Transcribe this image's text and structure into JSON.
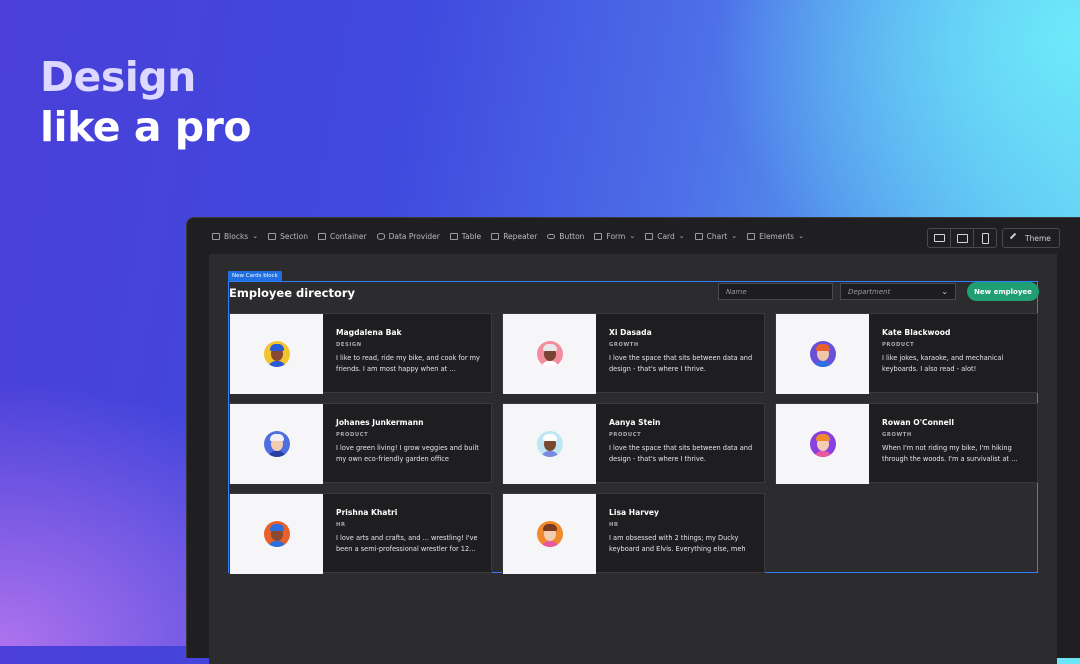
{
  "hero": {
    "line1": "Design",
    "line2": "like a pro"
  },
  "toolbar": {
    "items": [
      {
        "label": "Blocks",
        "icon": "blocks-icon",
        "dropdown": true
      },
      {
        "label": "Section",
        "icon": "section-icon",
        "dropdown": false
      },
      {
        "label": "Container",
        "icon": "container-icon",
        "dropdown": false
      },
      {
        "label": "Data Provider",
        "icon": "database-icon",
        "dropdown": false
      },
      {
        "label": "Table",
        "icon": "table-icon",
        "dropdown": false
      },
      {
        "label": "Repeater",
        "icon": "repeater-icon",
        "dropdown": false
      },
      {
        "label": "Button",
        "icon": "button-icon",
        "dropdown": false
      },
      {
        "label": "Form",
        "icon": "form-icon",
        "dropdown": true
      },
      {
        "label": "Card",
        "icon": "card-icon",
        "dropdown": true
      },
      {
        "label": "Chart",
        "icon": "chart-icon",
        "dropdown": true
      },
      {
        "label": "Elements",
        "icon": "elements-icon",
        "dropdown": true
      }
    ],
    "devices": [
      "desktop-icon",
      "tablet-icon",
      "mobile-icon"
    ],
    "theme_label": "Theme"
  },
  "canvas": {
    "block_tag": "New Cards block",
    "title": "Employee directory",
    "name_placeholder": "Name",
    "department_placeholder": "Department",
    "new_button": "New employee"
  },
  "employees": [
    {
      "name": "Magdalena Bak",
      "department": "DESIGN",
      "bio": "I like to read, ride my bike, and cook for my friends. I am most happy when at …",
      "avatar_bg": "#f4c430",
      "hair": "#2a5bd7",
      "skin": "#8a4a32",
      "shirt": "#2a5bd7"
    },
    {
      "name": "Xi Dasada",
      "department": "GROWTH",
      "bio": "I love the space that sits between data and design - that's where I thrive.",
      "avatar_bg": "#f28c9e",
      "hair": "#e8e8ea",
      "skin": "#7a4230",
      "shirt": "#ffffff"
    },
    {
      "name": "Kate Blackwood",
      "department": "PRODUCT",
      "bio": "I like jokes, karaoke, and mechanical keyboards.  I also read - alot!",
      "avatar_bg": "#6a4fd8",
      "hair": "#e8612c",
      "skin": "#f0c6a8",
      "shirt": "#2f6fe0"
    },
    {
      "name": "Johanes Junkermann",
      "department": "PRODUCT",
      "bio": "I love green living! I grow veggies and built my own eco-friendly garden office",
      "avatar_bg": "#4f6fe0",
      "hair": "#f2f2f4",
      "skin": "#f3cdb2",
      "shirt": "#2a3fa0"
    },
    {
      "name": "Aanya Stein",
      "department": "PRODUCT",
      "bio": "I love the space that sits between data and design - that's where I thrive.",
      "avatar_bg": "#bfe6f2",
      "hair": "#ffffff",
      "skin": "#7a4a30",
      "shirt": "#7a8ae0"
    },
    {
      "name": "Rowan O'Connell",
      "department": "GROWTH",
      "bio": "When I'm not riding my bike, I'm hiking through the woods. I'm a survivalist at …",
      "avatar_bg": "#8a3fe0",
      "hair": "#f08a2c",
      "skin": "#f3cdb2",
      "shirt": "#e85aa0"
    },
    {
      "name": "Prishna Khatri",
      "department": "HR",
      "bio": "I love arts and crafts, and ... wrestling! I've been a semi-professional wrestler for 12…",
      "avatar_bg": "#e8612c",
      "hair": "#2a6fe0",
      "skin": "#8a4a32",
      "shirt": "#2a6fe0"
    },
    {
      "name": "Lisa Harvey",
      "department": "HR",
      "bio": "I am obsessed with 2 things; my Ducky keyboard and Elvis. Everything else, meh",
      "avatar_bg": "#f08a2c",
      "hair": "#7a3a20",
      "skin": "#f3cdb2",
      "shirt": "#e85aa0"
    }
  ]
}
